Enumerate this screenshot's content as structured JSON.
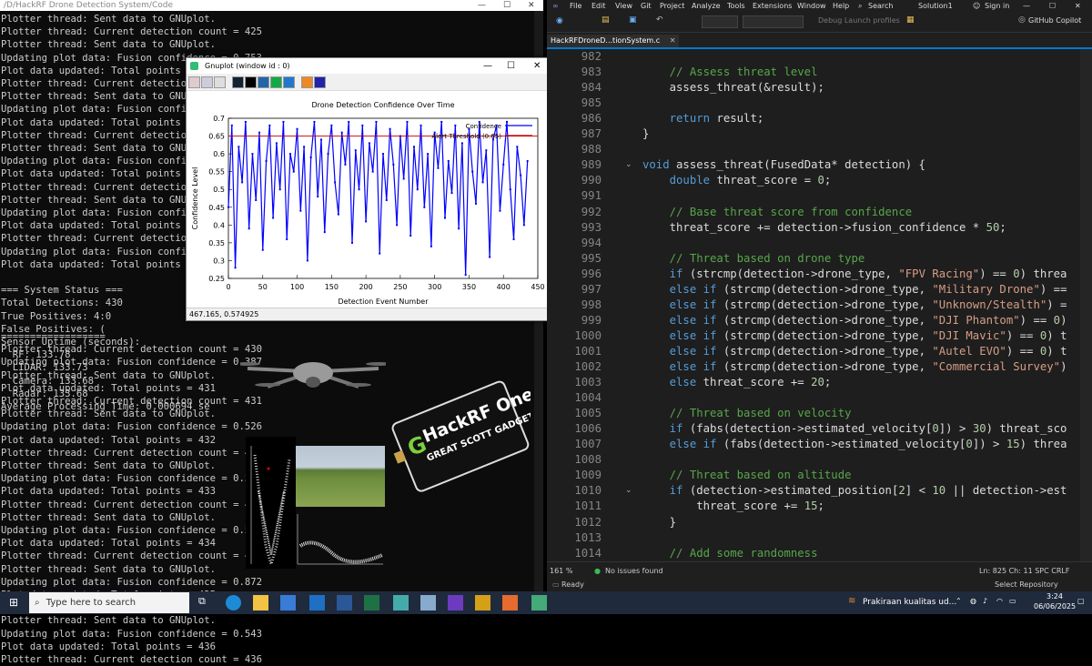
{
  "console": {
    "title": "/D/HackRF Drone Detection System/Code",
    "lines_top": [
      "Plotter thread: Sent data to GNUplot.",
      "Plotter thread: Current detection count = 425",
      "Plotter thread: Sent data to GNUplot.",
      "Updating plot data: Fusion confidence = 0.753",
      "Plot data updated: Total points = 426",
      "Plotter thread: Current detection co",
      "Plotter thread: Sent data to GNUplot",
      "Updating plot data: Fusion confidence",
      "Plot data updated: Total points = 42",
      "Plotter thread: Current detection co",
      "Plotter thread: Sent data to GNUplot",
      "Updating plot data: Fusion confidence",
      "Plot data updated: Total points = 42",
      "Plotter thread: Current detection co",
      "Plotter thread: Sent data to GNUplot",
      "Updating plot data: Fusion confidence",
      "Plot data updated: Total points = 42",
      "Plotter thread: Current detection co",
      "Updating plot data: Fusion confidence",
      "Plot data updated: Total points = 43",
      "",
      "=== System Status ===",
      "Total Detections: 430",
      "True Positives: 4:0",
      "False Positives: (",
      "Sensor Uptime (seconds):",
      "  RF: 133.78",
      "  LIDAR: 133.73",
      "  Camera: 133.68",
      "  Radar: 133.68",
      "Average Processing Time: 0.000694 se"
    ],
    "lines_bottom": [
      "==================",
      "Plotter thread: Current detection count = 430",
      "Updating plot data: Fusion confidence = 0.387",
      "Plotter thread: Sent data to GNUplot.",
      "Plot data updated: Total points = 431",
      "Plotter thread: Current detection count = 431",
      "Plotter thread: Sent data to GNUplot.",
      "Updating plot data: Fusion confidence = 0.526",
      "Plot data updated: Total points = 432",
      "Plotter thread: Current detection count = 432",
      "Plotter thread: Sent data to GNUplot.",
      "Updating plot data: Fusion confidence = 0.592",
      "Plot data updated: Total points = 433",
      "Plotter thread: Current detection count = 433",
      "Plotter thread: Sent data to GNUplot.",
      "Updating plot data: Fusion confidence = 0.577",
      "Plot data updated: Total points = 434",
      "Plotter thread: Current detection count = 434",
      "Plotter thread: Sent data to GNUplot.",
      "Updating plot data: Fusion confidence = 0.872",
      "Plot data updated: Total points = 435",
      "Plotter thread: Current detection count = 435",
      "Plotter thread: Sent data to GNUplot.",
      "Updating plot data: Fusion confidence = 0.543",
      "Plot data updated: Total points = 436",
      "Plotter thread: Current detection count = 436"
    ]
  },
  "gnuplot": {
    "window_title": "Gnuplot (window id : 0)",
    "status": "467.165, 0.574925",
    "colors": {
      "line": "#0000ff",
      "ref": "#c00000"
    }
  },
  "chart_data": {
    "type": "line",
    "title": "Drone Detection Confidence Over Time",
    "xlabel": "Detection Event Number",
    "ylabel": "Confidence Level",
    "xlim": [
      0,
      450
    ],
    "ylim": [
      0.25,
      0.7
    ],
    "x_ticks": [
      "0",
      "50",
      "100",
      "150",
      "200",
      "250",
      "300",
      "350",
      "400",
      "450"
    ],
    "y_ticks": [
      "0.25",
      "0.3",
      "0.35",
      "0.4",
      "0.45",
      "0.5",
      "0.55",
      "0.6",
      "0.65",
      "0.7"
    ],
    "legend": [
      "Confidence",
      "Alert Threshold (0.65)"
    ],
    "series": [
      {
        "name": "Confidence",
        "color": "#0000ff",
        "x": [
          0,
          5,
          10,
          15,
          20,
          25,
          30,
          35,
          40,
          45,
          50,
          55,
          60,
          65,
          70,
          75,
          80,
          85,
          90,
          95,
          100,
          105,
          110,
          115,
          120,
          125,
          130,
          135,
          140,
          145,
          150,
          155,
          160,
          165,
          170,
          175,
          180,
          185,
          190,
          195,
          200,
          205,
          210,
          215,
          220,
          225,
          230,
          235,
          240,
          245,
          250,
          255,
          260,
          265,
          270,
          275,
          280,
          285,
          290,
          295,
          300,
          305,
          310,
          315,
          320,
          325,
          330,
          335,
          340,
          345,
          350,
          355,
          360,
          365,
          370,
          375,
          380,
          385,
          390,
          395,
          400,
          405,
          410,
          415,
          420,
          425,
          430,
          435
        ],
        "y": [
          0.45,
          0.68,
          0.28,
          0.62,
          0.52,
          0.69,
          0.39,
          0.6,
          0.47,
          0.66,
          0.33,
          0.58,
          0.68,
          0.42,
          0.63,
          0.5,
          0.69,
          0.36,
          0.6,
          0.55,
          0.67,
          0.44,
          0.62,
          0.3,
          0.59,
          0.69,
          0.48,
          0.64,
          0.38,
          0.6,
          0.68,
          0.52,
          0.43,
          0.66,
          0.57,
          0.69,
          0.35,
          0.61,
          0.5,
          0.68,
          0.41,
          0.63,
          0.55,
          0.69,
          0.32,
          0.6,
          0.47,
          0.67,
          0.57,
          0.4,
          0.65,
          0.53,
          0.69,
          0.37,
          0.62,
          0.5,
          0.68,
          0.45,
          0.6,
          0.34,
          0.66,
          0.56,
          0.69,
          0.42,
          0.58,
          0.49,
          0.68,
          0.39,
          0.63,
          0.26,
          0.67,
          0.55,
          0.46,
          0.69,
          0.52,
          0.61,
          0.31,
          0.64,
          0.68,
          0.44,
          0.57,
          0.69,
          0.5,
          0.36,
          0.62,
          0.54,
          0.4,
          0.58
        ]
      }
    ],
    "threshold": 0.65
  },
  "vs": {
    "menu": [
      "File",
      "Edit",
      "View",
      "Git",
      "Project",
      "Analyze",
      "Tools",
      "Extensions",
      "Window",
      "Help"
    ],
    "search": "Search",
    "solution": "Solution1",
    "sign_in": "Sign in",
    "debug_profiles": "Debug Launch profiles",
    "copilot": "GitHub Copilot",
    "tab": "HackRFDroneD...tionSystem.c",
    "zoom": "161 %",
    "issues": "No issues found",
    "position": "Ln: 825    Ch: 11    SPC    CRLF",
    "ready": "Ready",
    "select_repo": "Select Repository",
    "line_numbers": [
      "982",
      "983",
      "984",
      "985",
      "986",
      "987",
      "988",
      "989",
      "990",
      "991",
      "992",
      "993",
      "994",
      "995",
      "996",
      "997",
      "998",
      "999",
      "1000",
      "1001",
      "1002",
      "1003",
      "1004",
      "1005",
      "1006",
      "1007",
      "1008",
      "1009",
      "1010",
      "1011",
      "1012",
      "1013",
      "1014"
    ],
    "code": [
      "    ",
      "    // Assess threat level",
      "    assess_threat(&result);",
      "",
      "    return result;",
      "}",
      "",
      "void assess_threat(FusedData* detection) {",
      "    double threat_score = 0;",
      "",
      "    // Base threat score from confidence",
      "    threat_score += detection->fusion_confidence * 50;",
      "",
      "    // Threat based on drone type",
      "    if (strcmp(detection->drone_type, \"FPV Racing\") == 0) threa",
      "    else if (strcmp(detection->drone_type, \"Military Drone\") ==",
      "    else if (strcmp(detection->drone_type, \"Unknown/Stealth\") =",
      "    else if (strcmp(detection->drone_type, \"DJI Phantom\") == 0)",
      "    else if (strcmp(detection->drone_type, \"DJI Mavic\") == 0) t",
      "    else if (strcmp(detection->drone_type, \"Autel EVO\") == 0) t",
      "    else if (strcmp(detection->drone_type, \"Commercial Survey\")",
      "    else threat_score += 20;",
      "",
      "    // Threat based on velocity",
      "    if (fabs(detection->estimated_velocity[0]) > 30) threat_sco",
      "    else if (fabs(detection->estimated_velocity[0]) > 15) threa",
      "",
      "    // Threat based on altitude",
      "    if (detection->estimated_position[2] < 10 || detection->est",
      "        threat_score += 15;",
      "    }",
      "",
      "    // Add some randomness"
    ]
  },
  "hackrf": {
    "line1": "HackRF One",
    "line2": "GREAT SCOTT GADGETS"
  },
  "taskbar": {
    "search_placeholder": "Type here to search",
    "weather": "Prakiraan kualitas ud...",
    "time": "3:24",
    "date": "06/06/2025"
  }
}
